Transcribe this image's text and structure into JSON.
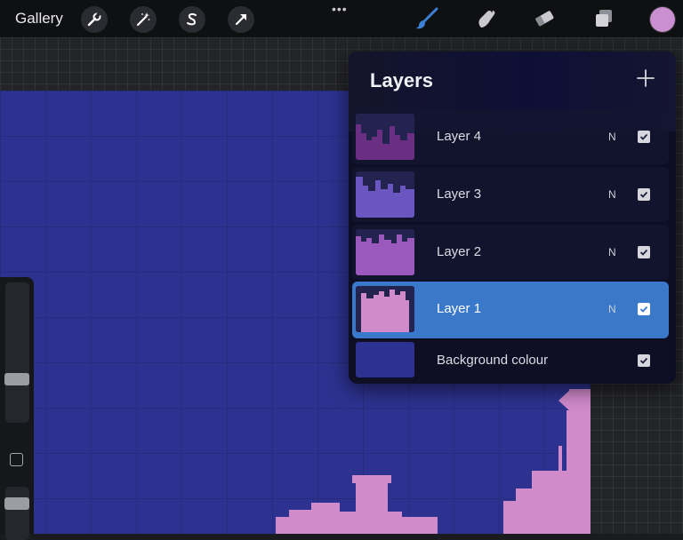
{
  "toolbar": {
    "gallery_label": "Gallery",
    "tools": [
      "wrench-icon",
      "magic-wand-icon",
      "selection-s-icon",
      "transform-arrow-icon"
    ],
    "right_tools": [
      "brush-icon",
      "smudge-icon",
      "eraser-icon",
      "layers-icon"
    ],
    "more": "•••",
    "current_color": "#c98fd0",
    "accent": "#3b82d6"
  },
  "layers": {
    "title": "Layers",
    "add_icon": "plus-icon",
    "items": [
      {
        "name": "Layer 4",
        "blend": "N",
        "visible": true,
        "selected": false,
        "thumb_color": "#6a2f82"
      },
      {
        "name": "Layer 3",
        "blend": "N",
        "visible": true,
        "selected": false,
        "thumb_color": "#6a56c0"
      },
      {
        "name": "Layer 2",
        "blend": "N",
        "visible": true,
        "selected": false,
        "thumb_color": "#9b59bd"
      },
      {
        "name": "Layer 1",
        "blend": "N",
        "visible": true,
        "selected": true,
        "thumb_color": "#d18bcb"
      }
    ],
    "background": {
      "name": "Background colour",
      "visible": true,
      "color": "#2d3290"
    }
  },
  "colors": {
    "canvas": "#2d3290",
    "silhouette": "#d18bcb",
    "selected_row": "#3a78c9"
  }
}
